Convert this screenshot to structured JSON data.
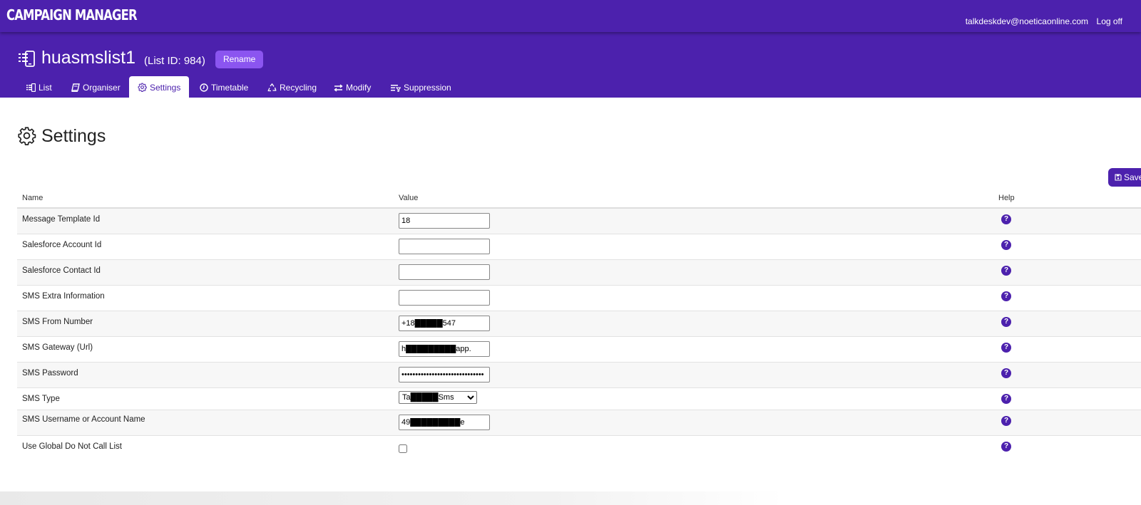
{
  "app": {
    "title": "CAMPAIGN MANAGER",
    "user": "talkdeskdev@noeticaonline.com",
    "logoff": "Log off"
  },
  "list": {
    "name": "huasmslist1",
    "id_label": "(List ID: 984)",
    "rename": "Rename"
  },
  "tabs": [
    {
      "label": "List",
      "icon": "list-icon"
    },
    {
      "label": "Organiser",
      "icon": "book-icon"
    },
    {
      "label": "Settings",
      "icon": "gear-icon",
      "active": true
    },
    {
      "label": "Timetable",
      "icon": "clock-icon"
    },
    {
      "label": "Recycling",
      "icon": "recycle-icon"
    },
    {
      "label": "Modify",
      "icon": "arrows-icon"
    },
    {
      "label": "Suppression",
      "icon": "filter-list-icon"
    }
  ],
  "page": {
    "title": "Settings",
    "save": "Save"
  },
  "table": {
    "headers": {
      "name": "Name",
      "value": "Value",
      "help": "Help"
    },
    "rows": [
      {
        "name": "Message Template Id",
        "type": "text",
        "value": "18"
      },
      {
        "name": "Salesforce Account Id",
        "type": "text",
        "value": ""
      },
      {
        "name": "Salesforce Contact Id",
        "type": "text",
        "value": ""
      },
      {
        "name": "SMS Extra Information",
        "type": "text",
        "value": ""
      },
      {
        "name": "SMS From Number",
        "type": "text",
        "value": "+18█████547"
      },
      {
        "name": "SMS Gateway (Url)",
        "type": "text",
        "value": "h█████████app."
      },
      {
        "name": "SMS Password",
        "type": "password",
        "value": "••••••••••••••••••••••••••••••"
      },
      {
        "name": "SMS Type",
        "type": "select",
        "value": "Ta█████Sms"
      },
      {
        "name": "SMS Username or Account Name",
        "type": "text",
        "value": "49█████████e"
      },
      {
        "name": "Use Global Do Not Call List",
        "type": "checkbox",
        "checked": false
      }
    ],
    "help_glyph": "?"
  },
  "colors": {
    "brand": "#4c21ad",
    "button": "#8b55f0"
  }
}
